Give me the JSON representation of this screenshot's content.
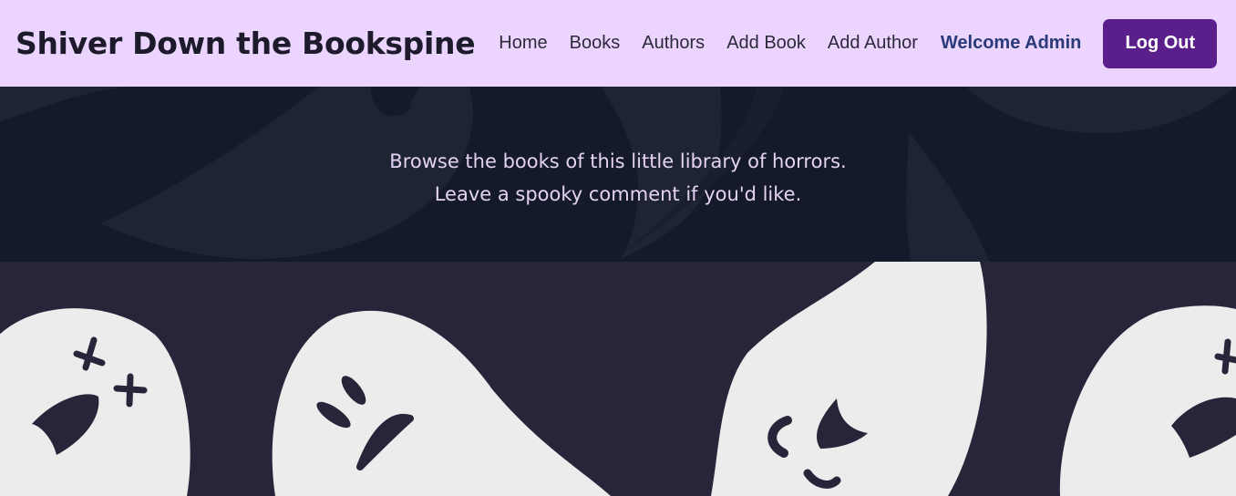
{
  "brand": {
    "title": "Shiver Down the Bookspine"
  },
  "nav": {
    "links": [
      "Home",
      "Books",
      "Authors",
      "Add Book",
      "Add Author"
    ],
    "welcome": "Welcome Admin",
    "logout_label": "Log Out"
  },
  "hero": {
    "line1": "Browse the books of this little library of horrors.",
    "line2": "Leave a spooky comment if you'd like."
  },
  "colors": {
    "navbar_bg": "#ebd5ff",
    "accent_button": "#5a1f8a",
    "welcome_text": "#2a3a78",
    "hero_bg": "#151a2a",
    "pattern_bg": "#26253a",
    "ghost": "#ececec"
  },
  "icons": [
    "ghost-dizzy-icon",
    "ghost-angry-icon",
    "ghost-laughing-icon"
  ]
}
